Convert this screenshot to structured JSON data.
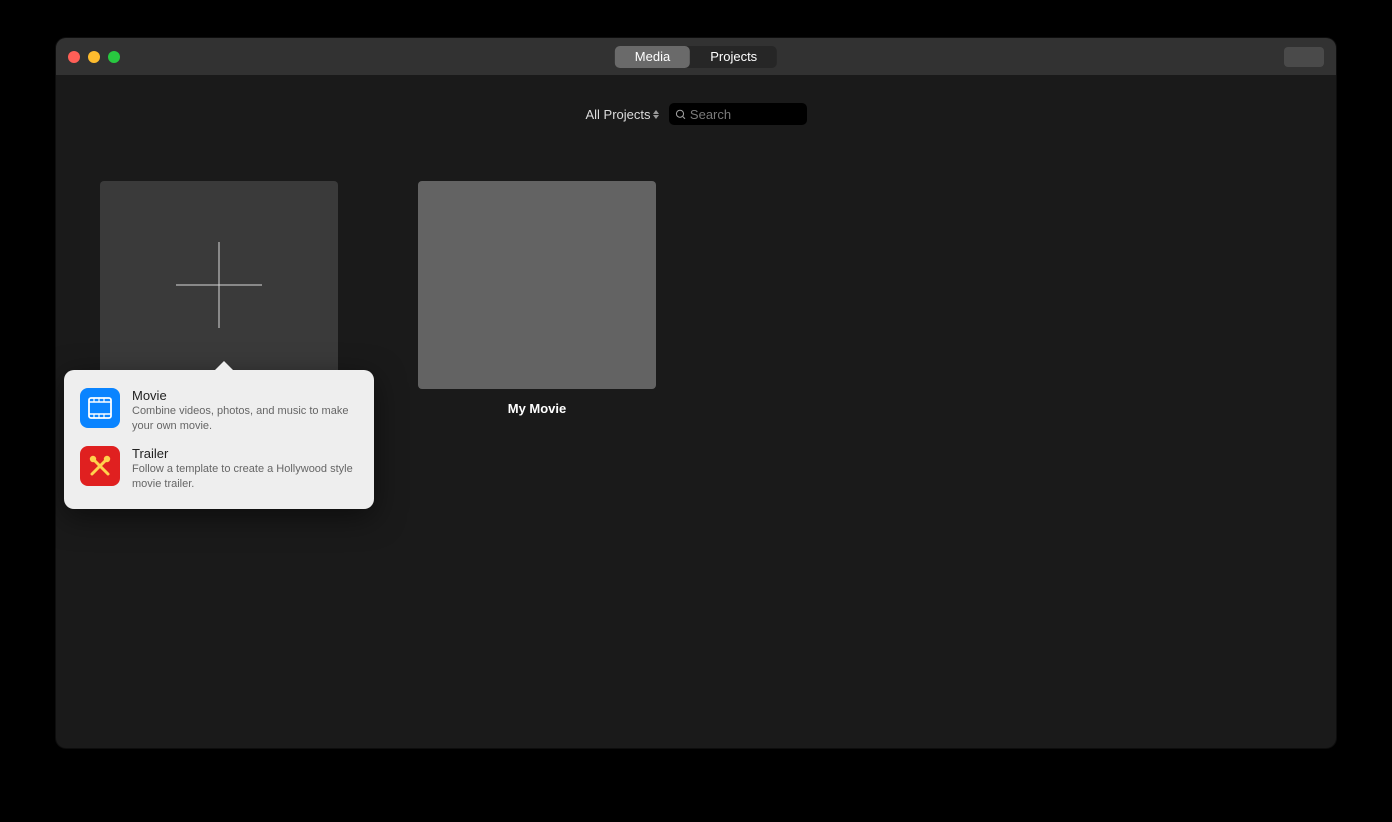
{
  "toolbar": {
    "tabs": {
      "media": "Media",
      "projects": "Projects"
    }
  },
  "filter": {
    "dropdown_label": "All Projects",
    "search_placeholder": "Search"
  },
  "projects": [
    {
      "title": "My Movie"
    }
  ],
  "popover": {
    "movie": {
      "title": "Movie",
      "desc": "Combine videos, photos, and music to make your own movie."
    },
    "trailer": {
      "title": "Trailer",
      "desc": "Follow a template to create a Hollywood style movie trailer."
    }
  }
}
